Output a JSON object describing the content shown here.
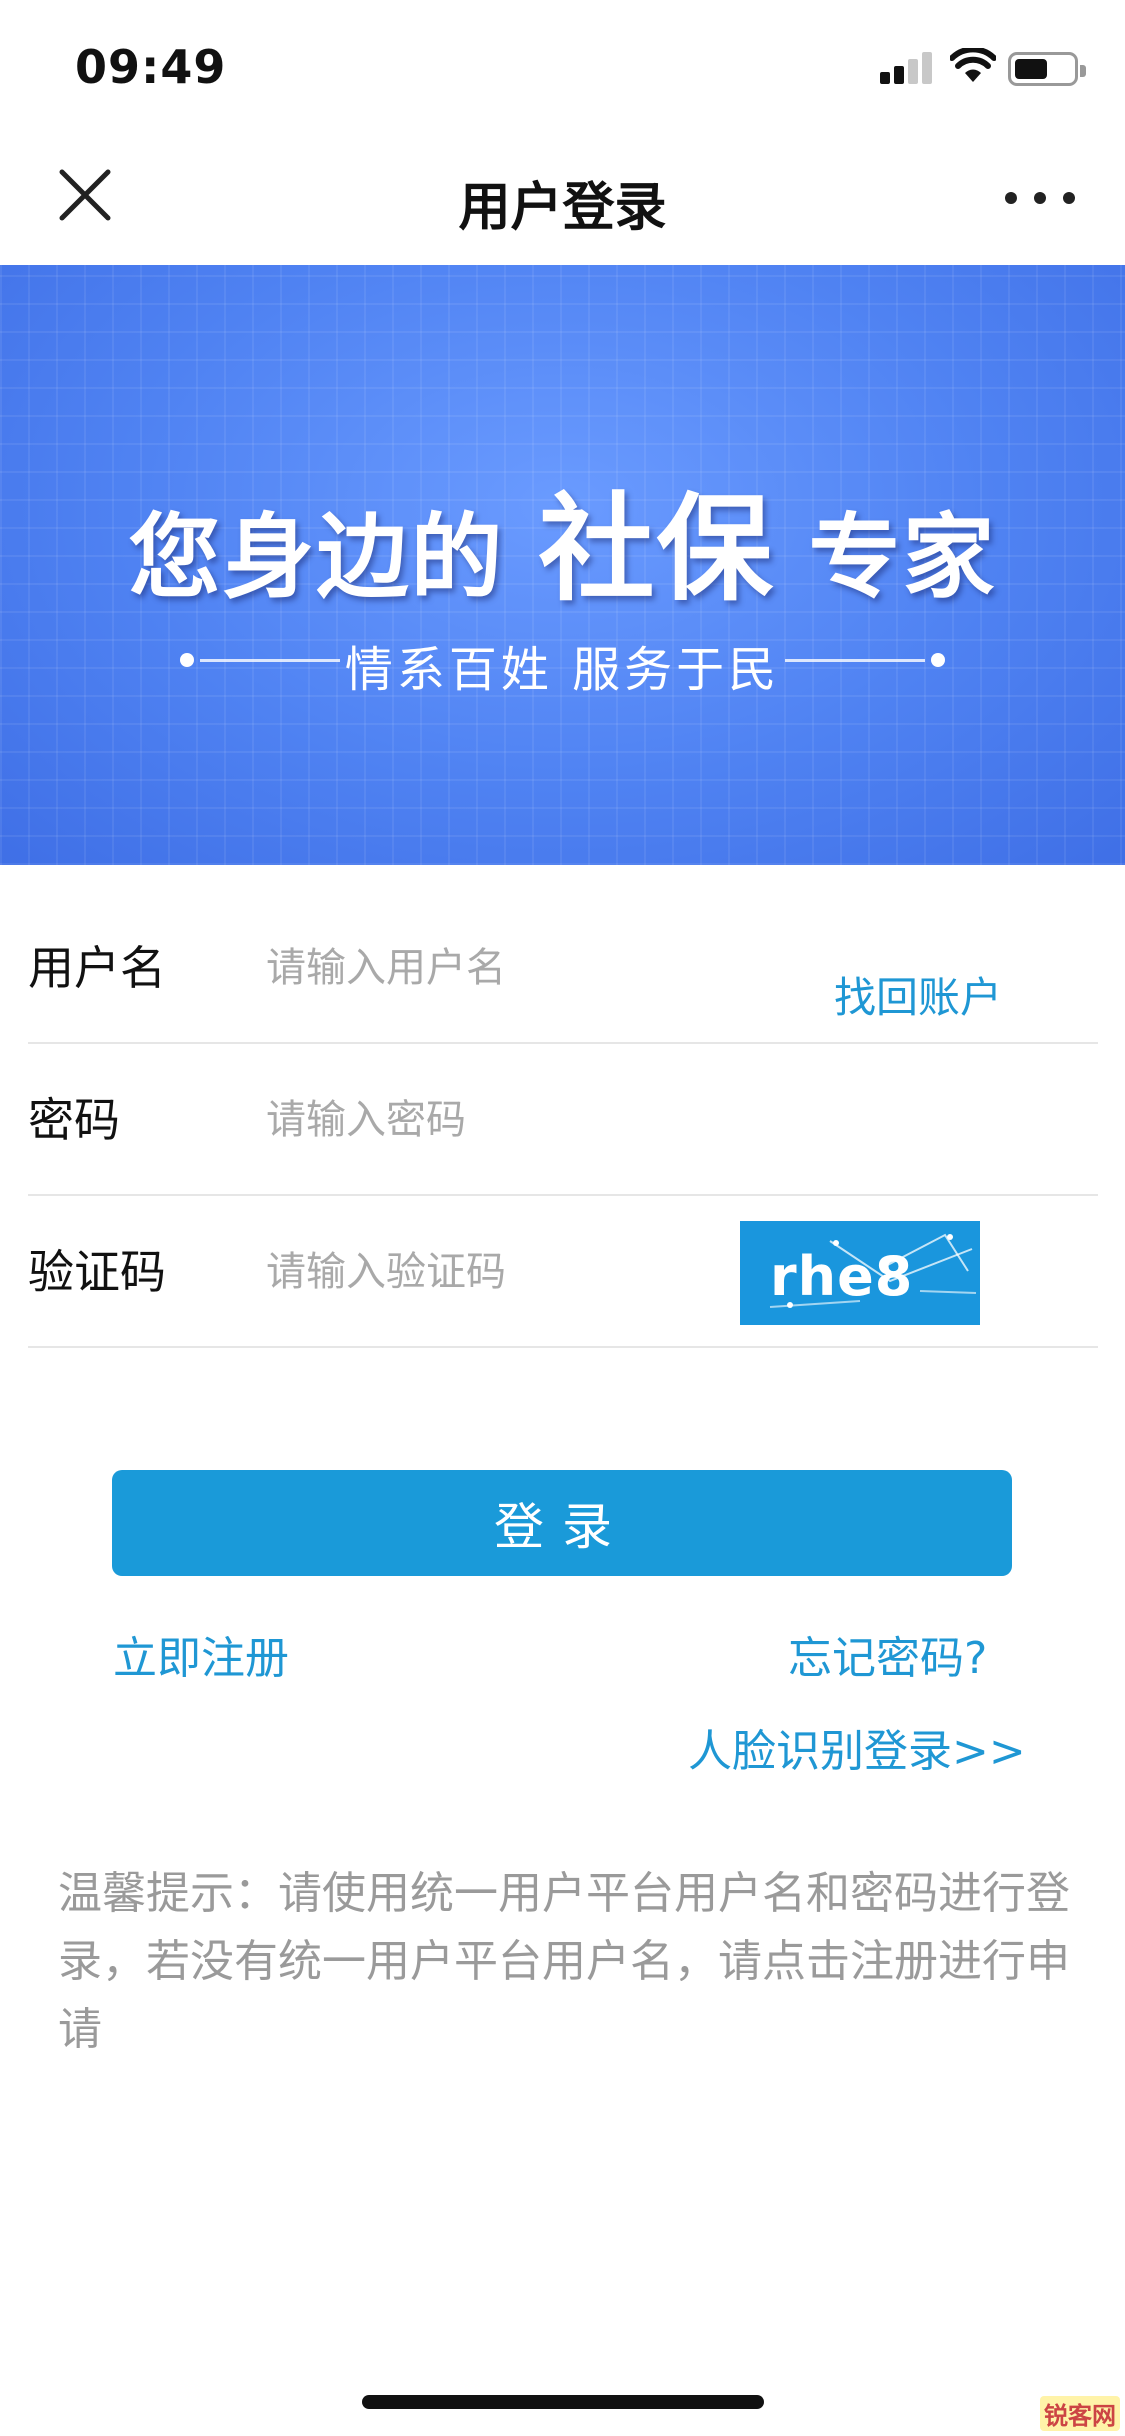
{
  "status_bar": {
    "time": "09:49"
  },
  "nav": {
    "title": "用户登录",
    "close_icon": "close-icon",
    "more_icon": "more-icon"
  },
  "banner": {
    "title_a": "您身边的",
    "title_b": "社保",
    "title_c": "专家",
    "subtitle": "情系百姓   服务于民",
    "color": "#4f82f2"
  },
  "form": {
    "username": {
      "label": "用户名",
      "placeholder": "请输入用户名",
      "value": ""
    },
    "recover_account": "找回账户",
    "password": {
      "label": "密码",
      "placeholder": "请输入密码",
      "value": ""
    },
    "captcha": {
      "label": "验证码",
      "placeholder": "请输入验证码",
      "value": "",
      "image_text": "rhe8"
    }
  },
  "actions": {
    "login": "登录",
    "register": "立即注册",
    "forgot_password": "忘记密码?",
    "face_login": "人脸识别登录>>"
  },
  "tip": "温馨提示：请使用统一用户平台用户名和密码进行登录，若没有统一用户平台用户名，请点击注册进行申请",
  "watermark": "锐客网",
  "colors": {
    "accent": "#1a9ad9",
    "link": "#1f97d4",
    "placeholder": "#a9a9a9"
  }
}
